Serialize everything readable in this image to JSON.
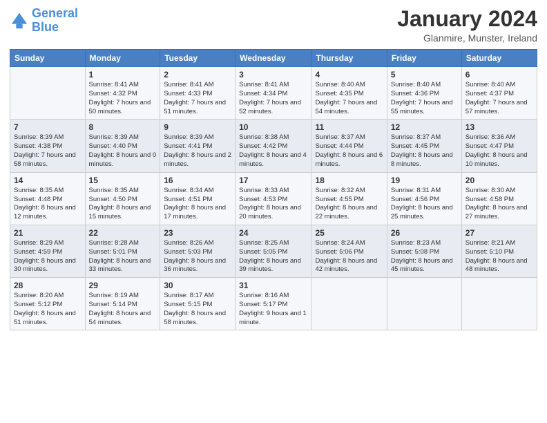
{
  "header": {
    "logo_line1": "General",
    "logo_line2": "Blue",
    "month": "January 2024",
    "location": "Glanmire, Munster, Ireland"
  },
  "days_of_week": [
    "Sunday",
    "Monday",
    "Tuesday",
    "Wednesday",
    "Thursday",
    "Friday",
    "Saturday"
  ],
  "weeks": [
    [
      {
        "day": "",
        "sunrise": "",
        "sunset": "",
        "daylight": ""
      },
      {
        "day": "1",
        "sunrise": "Sunrise: 8:41 AM",
        "sunset": "Sunset: 4:32 PM",
        "daylight": "Daylight: 7 hours and 50 minutes."
      },
      {
        "day": "2",
        "sunrise": "Sunrise: 8:41 AM",
        "sunset": "Sunset: 4:33 PM",
        "daylight": "Daylight: 7 hours and 51 minutes."
      },
      {
        "day": "3",
        "sunrise": "Sunrise: 8:41 AM",
        "sunset": "Sunset: 4:34 PM",
        "daylight": "Daylight: 7 hours and 52 minutes."
      },
      {
        "day": "4",
        "sunrise": "Sunrise: 8:40 AM",
        "sunset": "Sunset: 4:35 PM",
        "daylight": "Daylight: 7 hours and 54 minutes."
      },
      {
        "day": "5",
        "sunrise": "Sunrise: 8:40 AM",
        "sunset": "Sunset: 4:36 PM",
        "daylight": "Daylight: 7 hours and 55 minutes."
      },
      {
        "day": "6",
        "sunrise": "Sunrise: 8:40 AM",
        "sunset": "Sunset: 4:37 PM",
        "daylight": "Daylight: 7 hours and 57 minutes."
      }
    ],
    [
      {
        "day": "7",
        "sunrise": "Sunrise: 8:39 AM",
        "sunset": "Sunset: 4:38 PM",
        "daylight": "Daylight: 7 hours and 58 minutes."
      },
      {
        "day": "8",
        "sunrise": "Sunrise: 8:39 AM",
        "sunset": "Sunset: 4:40 PM",
        "daylight": "Daylight: 8 hours and 0 minutes."
      },
      {
        "day": "9",
        "sunrise": "Sunrise: 8:39 AM",
        "sunset": "Sunset: 4:41 PM",
        "daylight": "Daylight: 8 hours and 2 minutes."
      },
      {
        "day": "10",
        "sunrise": "Sunrise: 8:38 AM",
        "sunset": "Sunset: 4:42 PM",
        "daylight": "Daylight: 8 hours and 4 minutes."
      },
      {
        "day": "11",
        "sunrise": "Sunrise: 8:37 AM",
        "sunset": "Sunset: 4:44 PM",
        "daylight": "Daylight: 8 hours and 6 minutes."
      },
      {
        "day": "12",
        "sunrise": "Sunrise: 8:37 AM",
        "sunset": "Sunset: 4:45 PM",
        "daylight": "Daylight: 8 hours and 8 minutes."
      },
      {
        "day": "13",
        "sunrise": "Sunrise: 8:36 AM",
        "sunset": "Sunset: 4:47 PM",
        "daylight": "Daylight: 8 hours and 10 minutes."
      }
    ],
    [
      {
        "day": "14",
        "sunrise": "Sunrise: 8:35 AM",
        "sunset": "Sunset: 4:48 PM",
        "daylight": "Daylight: 8 hours and 12 minutes."
      },
      {
        "day": "15",
        "sunrise": "Sunrise: 8:35 AM",
        "sunset": "Sunset: 4:50 PM",
        "daylight": "Daylight: 8 hours and 15 minutes."
      },
      {
        "day": "16",
        "sunrise": "Sunrise: 8:34 AM",
        "sunset": "Sunset: 4:51 PM",
        "daylight": "Daylight: 8 hours and 17 minutes."
      },
      {
        "day": "17",
        "sunrise": "Sunrise: 8:33 AM",
        "sunset": "Sunset: 4:53 PM",
        "daylight": "Daylight: 8 hours and 20 minutes."
      },
      {
        "day": "18",
        "sunrise": "Sunrise: 8:32 AM",
        "sunset": "Sunset: 4:55 PM",
        "daylight": "Daylight: 8 hours and 22 minutes."
      },
      {
        "day": "19",
        "sunrise": "Sunrise: 8:31 AM",
        "sunset": "Sunset: 4:56 PM",
        "daylight": "Daylight: 8 hours and 25 minutes."
      },
      {
        "day": "20",
        "sunrise": "Sunrise: 8:30 AM",
        "sunset": "Sunset: 4:58 PM",
        "daylight": "Daylight: 8 hours and 27 minutes."
      }
    ],
    [
      {
        "day": "21",
        "sunrise": "Sunrise: 8:29 AM",
        "sunset": "Sunset: 4:59 PM",
        "daylight": "Daylight: 8 hours and 30 minutes."
      },
      {
        "day": "22",
        "sunrise": "Sunrise: 8:28 AM",
        "sunset": "Sunset: 5:01 PM",
        "daylight": "Daylight: 8 hours and 33 minutes."
      },
      {
        "day": "23",
        "sunrise": "Sunrise: 8:26 AM",
        "sunset": "Sunset: 5:03 PM",
        "daylight": "Daylight: 8 hours and 36 minutes."
      },
      {
        "day": "24",
        "sunrise": "Sunrise: 8:25 AM",
        "sunset": "Sunset: 5:05 PM",
        "daylight": "Daylight: 8 hours and 39 minutes."
      },
      {
        "day": "25",
        "sunrise": "Sunrise: 8:24 AM",
        "sunset": "Sunset: 5:06 PM",
        "daylight": "Daylight: 8 hours and 42 minutes."
      },
      {
        "day": "26",
        "sunrise": "Sunrise: 8:23 AM",
        "sunset": "Sunset: 5:08 PM",
        "daylight": "Daylight: 8 hours and 45 minutes."
      },
      {
        "day": "27",
        "sunrise": "Sunrise: 8:21 AM",
        "sunset": "Sunset: 5:10 PM",
        "daylight": "Daylight: 8 hours and 48 minutes."
      }
    ],
    [
      {
        "day": "28",
        "sunrise": "Sunrise: 8:20 AM",
        "sunset": "Sunset: 5:12 PM",
        "daylight": "Daylight: 8 hours and 51 minutes."
      },
      {
        "day": "29",
        "sunrise": "Sunrise: 8:19 AM",
        "sunset": "Sunset: 5:14 PM",
        "daylight": "Daylight: 8 hours and 54 minutes."
      },
      {
        "day": "30",
        "sunrise": "Sunrise: 8:17 AM",
        "sunset": "Sunset: 5:15 PM",
        "daylight": "Daylight: 8 hours and 58 minutes."
      },
      {
        "day": "31",
        "sunrise": "Sunrise: 8:16 AM",
        "sunset": "Sunset: 5:17 PM",
        "daylight": "Daylight: 9 hours and 1 minute."
      },
      {
        "day": "",
        "sunrise": "",
        "sunset": "",
        "daylight": ""
      },
      {
        "day": "",
        "sunrise": "",
        "sunset": "",
        "daylight": ""
      },
      {
        "day": "",
        "sunrise": "",
        "sunset": "",
        "daylight": ""
      }
    ]
  ]
}
